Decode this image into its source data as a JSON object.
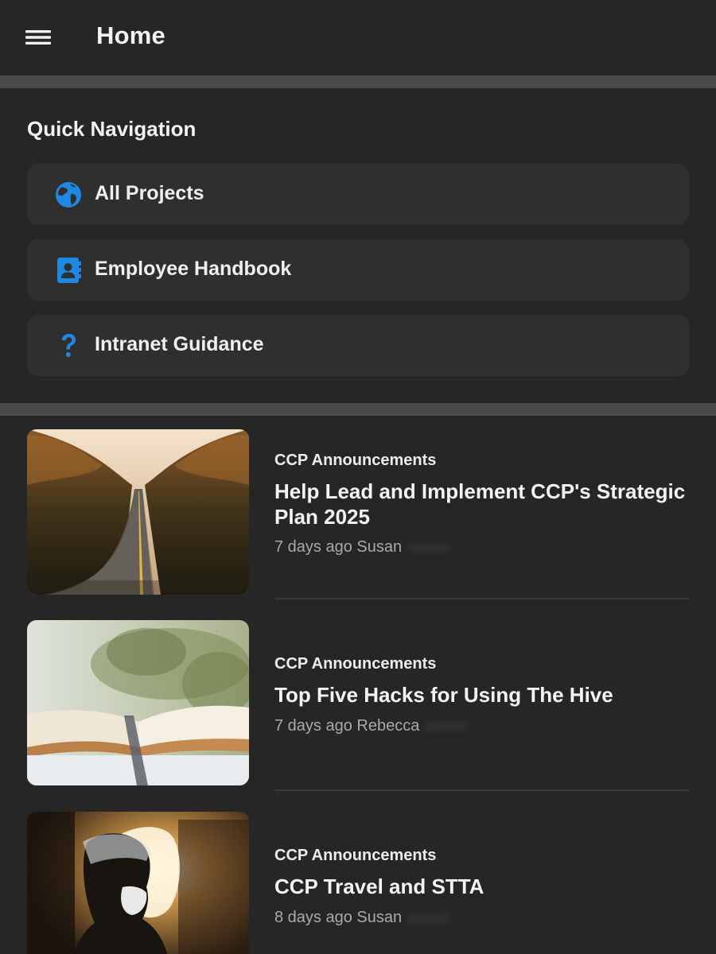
{
  "app_bar": {
    "title": "Home",
    "menu_icon": "hamburger-menu-icon"
  },
  "quick_navigation": {
    "title": "Quick Navigation",
    "accent_color": "#1e88e5",
    "items": [
      {
        "label": "All Projects",
        "icon": "globe-icon"
      },
      {
        "label": "Employee Handbook",
        "icon": "contact-book-icon"
      },
      {
        "label": "Intranet Guidance",
        "icon": "question-mark-icon"
      }
    ]
  },
  "articles": [
    {
      "category": "CCP Announcements",
      "title": "Help Lead and Implement CCP's Strategic Plan 2025",
      "time": "7 days ago",
      "author": "Susan",
      "thumbnail": "road-through-forest-image"
    },
    {
      "category": "CCP Announcements",
      "title": "Top Five Hacks for Using The Hive",
      "time": "7 days ago",
      "author": "Rebecca",
      "thumbnail": "open-book-image"
    },
    {
      "category": "CCP Announcements",
      "title": "CCP Travel and STTA",
      "time": "8 days ago",
      "author": "Susan",
      "thumbnail": "traveler-airplane-window-image"
    }
  ]
}
